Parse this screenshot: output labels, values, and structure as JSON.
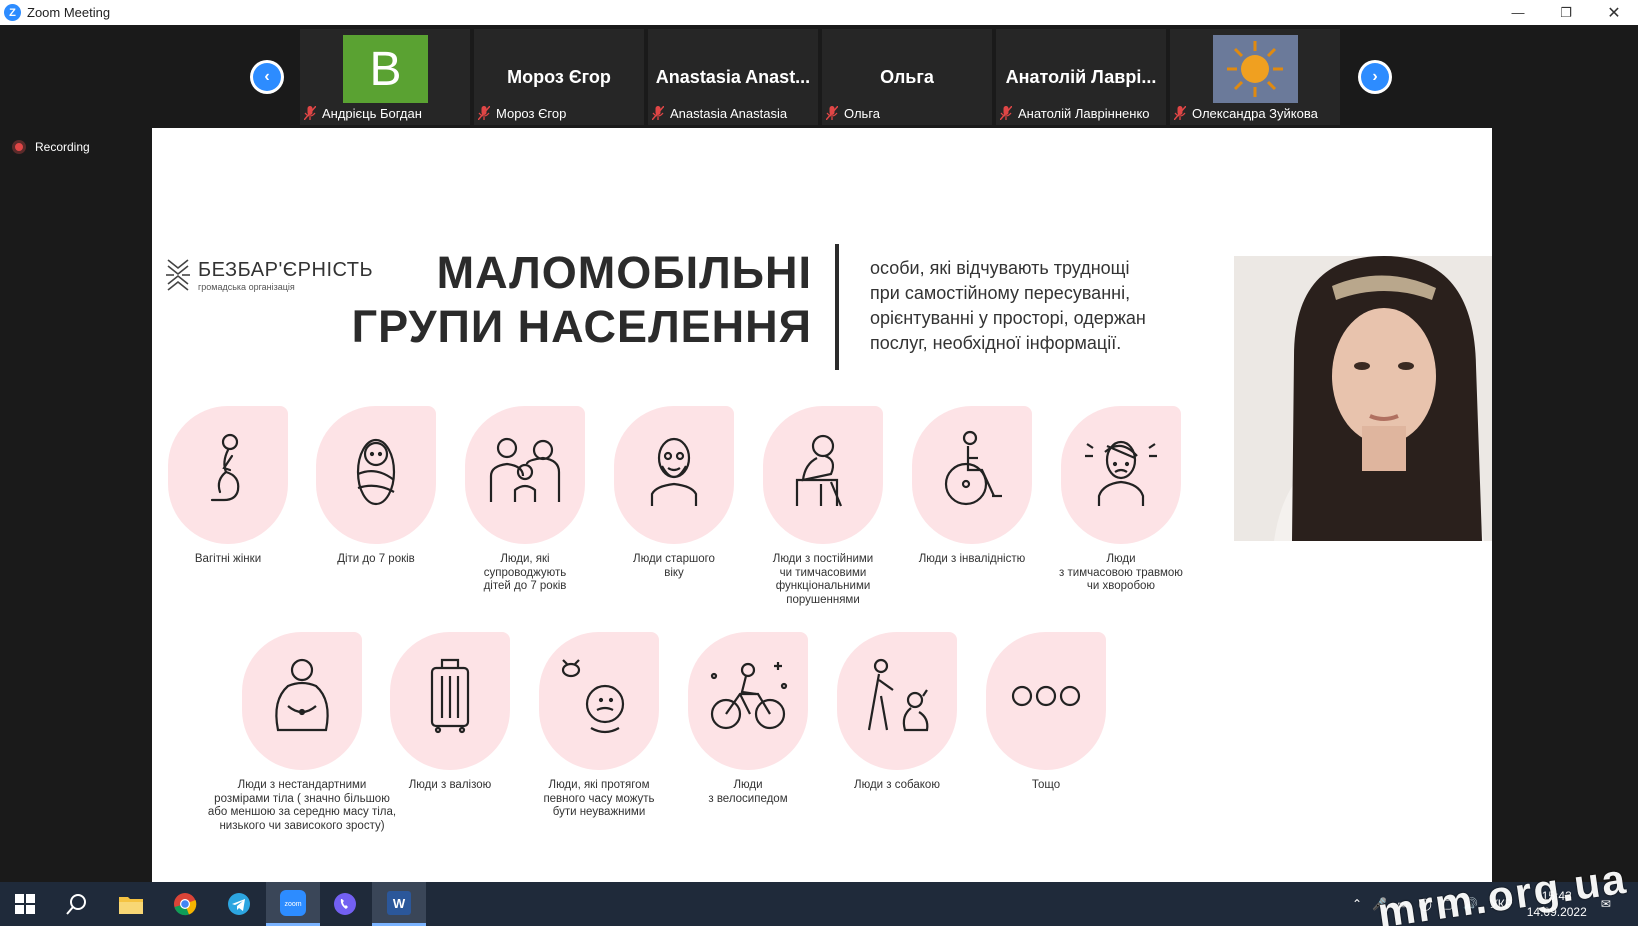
{
  "window": {
    "title": "Zoom Meeting"
  },
  "participants": [
    {
      "display": "B",
      "label": "Андрієць Богдан",
      "avatar_color": "#5aa232"
    },
    {
      "display": "Мороз Єгор",
      "label": "Мороз Єгор"
    },
    {
      "display": "Anastasia  Anast...",
      "label": "Anastasia Anastasia"
    },
    {
      "display": "Ольга",
      "label": "Ольга"
    },
    {
      "display": "Анатолій  Лаврі...",
      "label": "Анатолій Лаврінненко"
    },
    {
      "display": "",
      "label": "Олександра Зуйкова"
    }
  ],
  "recording": {
    "label": "Recording"
  },
  "slide": {
    "brand": {
      "name": "БЕЗБАР'ЄРНІСТЬ",
      "sub": "громадська організація"
    },
    "headline": [
      "МАЛОМОБІЛЬНІ",
      "ГРУПИ НАСЕЛЕННЯ"
    ],
    "description": [
      "особи, які відчувають труднощі",
      "при самостійному пересуванні,",
      "орієнтуванні у просторі, одержан",
      "послуг, необхідної інформації."
    ],
    "row1": [
      {
        "icon": "pregnant-icon",
        "caption": [
          "Вагітні жінки"
        ]
      },
      {
        "icon": "baby-icon",
        "caption": [
          "Діти до 7 років"
        ]
      },
      {
        "icon": "family-icon",
        "caption": [
          "Люди, які",
          "супроводжують",
          "дітей до 7 років"
        ]
      },
      {
        "icon": "elderly-icon",
        "caption": [
          "Люди старшого",
          "віку"
        ]
      },
      {
        "icon": "walker-icon",
        "caption": [
          "Люди з постійними",
          "чи тимчасовими",
          "функціональними",
          "порушеннями"
        ]
      },
      {
        "icon": "wheelchair-icon",
        "caption": [
          "Люди з інвалідністю"
        ]
      },
      {
        "icon": "injury-icon",
        "caption": [
          "Люди",
          "з тимчасовою травмою",
          "чи хворобою"
        ]
      }
    ],
    "row2": [
      {
        "icon": "body-size-icon",
        "caption": [
          "Люди з нестандартними",
          "розмірами тіла ( значно більшою",
          "або меншою за середню масу тіла,",
          "низького чи зависокого зросту)"
        ]
      },
      {
        "icon": "suitcase-icon",
        "caption": [
          "Люди з валізою"
        ]
      },
      {
        "icon": "distracted-icon",
        "caption": [
          "Люди, які протягом",
          "певного часу можуть",
          "бути неуважними"
        ]
      },
      {
        "icon": "bicycle-icon",
        "caption": [
          "Люди",
          "з велосипедом"
        ]
      },
      {
        "icon": "dog-icon",
        "caption": [
          "Люди з собакою"
        ]
      },
      {
        "icon": "more-icon",
        "caption": [
          "Тощо"
        ]
      }
    ]
  },
  "taskbar": {
    "lang": "УКР",
    "time": "15:43",
    "date": "14.09.2022"
  },
  "watermark": "mrm.org.ua",
  "colors": {
    "accent": "#2d8cff",
    "tile": "#fde3e6",
    "record": "#e04646"
  }
}
